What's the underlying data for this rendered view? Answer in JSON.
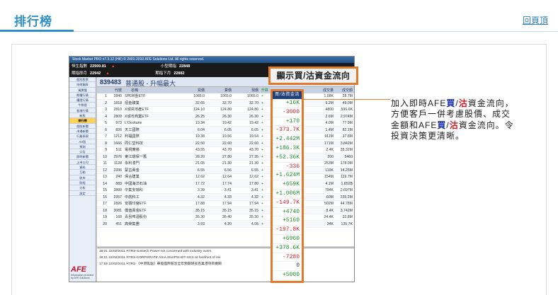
{
  "page": {
    "title": "排行榜",
    "top_link": "回頁頂"
  },
  "app": {
    "titlebar": "Stock Market PRO v7.3.12 (HK) © 2001-2010 AFE Solutions Ltd. All rights reserved.",
    "ticker1": {
      "label": "恒生指數",
      "value": "22900.81",
      "label2": "小型期指",
      "value2": "22848"
    },
    "ticker2": {
      "label": "期指即月",
      "value": "22942",
      "label2": "期指下月",
      "value2": "22882"
    },
    "sidebar": [
      "個別股票",
      "技術圖表",
      "買賣盤",
      "期權行情",
      "權證行情",
      "牛熊證",
      "板塊行情",
      "新股",
      "排行榜",
      "個股新聞",
      "市場新聞",
      "行業表現",
      "AH股",
      "預測",
      "公告",
      "即時新聞",
      "上市公司",
      "資料",
      "互動",
      "收市",
      "財經",
      "分析",
      "設定"
    ],
    "active_sidebar": "排行榜",
    "stock_code": "839483",
    "stock_name": "普通股 - 升幅最大",
    "columns": [
      "代號",
      "名稱",
      "買價",
      "賣價",
      "現價",
      "升跌",
      "成交量",
      "成交額"
    ],
    "rows": [
      {
        "no": "1",
        "code": "2840",
        "name": "SPDR金ETF",
        "p1": "1065.0",
        "p2": "1065.0",
        "p3": "1065.0",
        "vol": "1.08K",
        "to": "28.7M"
      },
      {
        "no": "2",
        "code": "1818",
        "name": "招金礦業",
        "p1": "32.65",
        "p2": "32.70",
        "p3": "32.70",
        "vol": "9.2M",
        "to": "49.0M"
      },
      {
        "no": "3",
        "code": "2810",
        "name": "X城央地產ETF",
        "p1": "124.10",
        "p2": "124.80",
        "p3": "124.80",
        "vol": "4800",
        "to": "596.6K"
      },
      {
        "no": "4",
        "code": "2809",
        "name": "X城市商業ETF",
        "p1": "26.25",
        "p2": "26.30",
        "p3": "26.30",
        "vol": "2.6M",
        "to": "2.974M"
      },
      {
        "no": "5",
        "code": "973",
        "name": "L'Occitane",
        "p1": "19.34",
        "p2": "19.42",
        "p3": "19.42",
        "vol": "4.0M",
        "to": "77.9M"
      },
      {
        "no": "6",
        "code": "826",
        "name": "天工國際",
        "p1": "6.04",
        "p2": "6.05",
        "p3": "6.05",
        "vol": "1.4M",
        "to": "82.1M"
      },
      {
        "no": "7",
        "code": "1212",
        "name": "利福國際",
        "p1": "19.38",
        "p2": "19.56",
        "p3": "19.54",
        "vol": "911M",
        "to": "37.8M"
      },
      {
        "no": "8",
        "code": "1666",
        "name": "同仁堂科技",
        "p1": "22.50",
        "p2": "22.60",
        "p3": "22.60",
        "vol": "171M",
        "to": "3.842M"
      },
      {
        "no": "9",
        "code": "511",
        "name": "電視廣播",
        "p1": "43.55",
        "p2": "43.70",
        "p3": "43.70",
        "vol": "2.4K",
        "to": "35.32M"
      },
      {
        "no": "10",
        "code": "2976",
        "name": "東江環保一舊",
        "p1": "28.20",
        "p2": "27.80",
        "p3": "27.35",
        "vol": "200",
        "to": "5460"
      },
      {
        "no": "11",
        "code": "1128",
        "name": "永利澳門",
        "p1": "21.05",
        "p2": "21.30",
        "p3": "21.30",
        "vol": "253M",
        "to": "178.0M"
      },
      {
        "no": "12",
        "code": "2336",
        "name": "蒙古黃金",
        "p1": "6.55",
        "p2": "6.56",
        "p3": "6.55",
        "vol": "119K",
        "to": "14.25M"
      },
      {
        "no": "13",
        "code": "240",
        "name": "保合建業",
        "p1": "12.62",
        "p2": "12.64",
        "p3": "12.62",
        "vol": "154M",
        "to": "119.7M"
      },
      {
        "no": "14",
        "code": "883",
        "name": "中國海洋石油",
        "p1": "17.72",
        "p2": "17.74",
        "p3": "17.80",
        "vol": "4.1M",
        "to": "1.852B"
      },
      {
        "no": "15",
        "code": "3899",
        "name": "中集安瑞科",
        "p1": "3.39",
        "p2": "3.41",
        "p3": "3.41",
        "vol": "794K",
        "to": "2.697M"
      },
      {
        "no": "16",
        "code": "2357",
        "name": "中航科工",
        "p1": "4.32",
        "p2": "4.33",
        "p3": "4.32",
        "vol": ".60M",
        "to": "235.2M"
      },
      {
        "no": "17",
        "code": "2826",
        "name": "安碩印度ETF",
        "p1": "17.88",
        "p2": "17.94",
        "p3": "17.94",
        "vol": "502M",
        "to": "44.78M"
      },
      {
        "no": "18",
        "code": "3081",
        "name": "價值黃金ETF",
        "p1": "35.15",
        "p2": "35.15",
        "p3": "35.15",
        "vol": "8.4K",
        "to": "3.742M"
      },
      {
        "no": "19",
        "code": "168",
        "name": "青島啤酒股份",
        "p1": "35.30",
        "p2": "35.40",
        "p3": "35.30",
        "vol": "24.4K",
        "to": "32.8M"
      },
      {
        "no": "20",
        "code": "451",
        "name": "高榮集團",
        "p1": "3.93",
        "p2": "4.20",
        "p3": "4.05",
        "vol": "34K",
        "to": "135.7K"
      }
    ],
    "news": [
      "18:01 22/02/2011 RTRS-Suntech Power not concerned with industry overs",
      "18:01 22/02/2011 RTRS-CORPORATE ASIA SNAPSHOT-SGX at forefront of Asi",
      "17:59 22/02/2011 RTRS-《中港焦點》華能國際股息全年預期增長百萬港項目機關"
    ],
    "logo": {
      "mark": "AFE",
      "sub": "Information provided by AFE Solutions"
    }
  },
  "flow": {
    "header": "買/沽資金流向",
    "values": [
      "+16K",
      "-3000",
      "+170",
      "-373.7K",
      "+2.442M",
      "+186.3K",
      "+52.36K",
      "-336",
      "+1.624M",
      "+659K",
      "+1.006M",
      "-149.7K",
      "+4740",
      "+5160",
      "-197.8K",
      "+6960",
      "+378.6K",
      "-7280",
      "0",
      "+5000"
    ]
  },
  "callout": {
    "label": "顯示買/沽資金流向"
  },
  "description": {
    "p1": "加入即時AFE",
    "buy": "買",
    "slash": "/",
    "sell": "沽",
    "p2": "資金流向，方便客戶一併考慮股價、成交金額和AFE",
    "buy2": "買",
    "slash2": "/",
    "sell2": "沽",
    "p3": "資金流向。令投資決策更清晰。"
  },
  "colors": {
    "accent": "#e07b2e",
    "title_blue": "#2f8fc9",
    "buy": "#1f34a8",
    "sell": "#d11a24",
    "positive": "#1e8f2a",
    "negative": "#c8232c"
  }
}
